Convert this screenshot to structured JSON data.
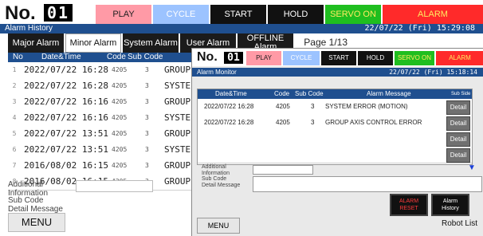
{
  "back": {
    "no_label": "No.",
    "no_digits": "01",
    "status": {
      "play": "PLAY",
      "cycle": "CYCLE",
      "start": "START",
      "hold": "HOLD",
      "servo": "SERVO ON",
      "alarm": "ALARM"
    },
    "title": "Alarm History",
    "datetime": "22/07/22 (Fri) 15:29:08",
    "tabs": [
      "Major Alarm",
      "Minor Alarm",
      "System Alarm",
      "User Alarm",
      "OFFLINE Alarm"
    ],
    "page": "Page 1/13",
    "table_headers": {
      "no": "No",
      "datetime": "Date&Time",
      "code": "Code",
      "subcode": "Sub Code"
    },
    "rows": [
      {
        "no": "1",
        "datetime": "2022/07/22 16:28",
        "code": "4205",
        "sub": "3",
        "msg": "GROUP"
      },
      {
        "no": "2",
        "datetime": "2022/07/22 16:28",
        "code": "4205",
        "sub": "3",
        "msg": "SYSTE"
      },
      {
        "no": "3",
        "datetime": "2022/07/22 16:16",
        "code": "4205",
        "sub": "3",
        "msg": "GROUP"
      },
      {
        "no": "4",
        "datetime": "2022/07/22 16:16",
        "code": "4205",
        "sub": "3",
        "msg": "SYSTE"
      },
      {
        "no": "5",
        "datetime": "2022/07/22 13:51",
        "code": "4205",
        "sub": "3",
        "msg": "GROUP"
      },
      {
        "no": "6",
        "datetime": "2022/07/22 13:51",
        "code": "4205",
        "sub": "3",
        "msg": "SYSTE"
      },
      {
        "no": "7",
        "datetime": "2016/08/02 16:15",
        "code": "4205",
        "sub": "3",
        "msg": "GROUP"
      },
      {
        "no": "8",
        "datetime": "2016/08/02 16:15",
        "code": "4205",
        "sub": "3",
        "msg": "GROUP"
      }
    ],
    "additional_label": "Additional\nInformation",
    "subcode_label": "Sub Code\nDetail Message",
    "menu": "MENU"
  },
  "front": {
    "no_label": "No.",
    "no_digits": "01",
    "status": {
      "play": "PLAY",
      "cycle": "CYCLE",
      "start": "START",
      "hold": "HOLD",
      "servo": "SERVO ON",
      "alarm": "ALARM"
    },
    "title": "Alarm Monitor",
    "datetime": "22/07/22 (Fri) 15:18:14",
    "headers": {
      "datetime": "Date&Time",
      "code": "Code",
      "subcode": "Sub Code",
      "message": "Alarm Message",
      "side": "Sub Side"
    },
    "rows": [
      {
        "datetime": "2022/07/22 16:28",
        "code": "4205",
        "sub": "3",
        "message": "SYSTEM ERROR (MOTION)",
        "detail": "Detail"
      },
      {
        "datetime": "2022/07/22 16:28",
        "code": "4205",
        "sub": "3",
        "message": "GROUP AXIS CONTROL ERROR",
        "detail": "Detail"
      },
      {
        "datetime": "",
        "code": "",
        "sub": "",
        "message": "",
        "detail": "Detail"
      },
      {
        "datetime": "",
        "code": "",
        "sub": "",
        "message": "",
        "detail": "Detail"
      }
    ],
    "additional_label": "Additional\nInformation",
    "subcode_label": "Sub Code\nDetail Message",
    "alarm_reset": "ALARM\nRESET",
    "alarm_history": "Alarm\nHistory",
    "menu": "MENU",
    "robot_list": "Robot List"
  },
  "colors": {
    "play": "#ff9aa6",
    "cycle": "#9cc3ff",
    "start_hold": "#111111",
    "servo": "#1fbe1f",
    "alarm": "#ff2a2a",
    "title": "#1f4f8f"
  }
}
